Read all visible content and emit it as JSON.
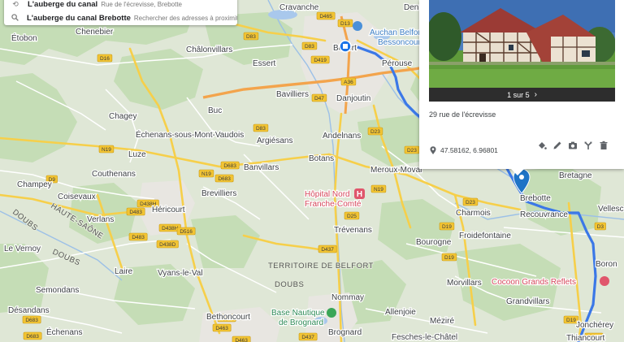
{
  "search": {
    "suggestions": [
      {
        "title": "L'auberge du canal",
        "subtitle": "Rue de l'écrevisse, Brebotte",
        "icon": "history-icon"
      },
      {
        "title": "L'auberge du canal Brebotte",
        "subtitle": "Rechercher des adresses à proximité de",
        "icon": "search-icon"
      }
    ]
  },
  "card": {
    "pager": "1 sur 5",
    "address": "29 rue de l'écrevisse",
    "coordinates": "47.58162, 6.96801",
    "tools": [
      "paint-bucket-icon",
      "pencil-icon",
      "camera-icon",
      "directions-icon",
      "trash-icon"
    ]
  },
  "map": {
    "towns": [
      "Cravanche",
      "Chenebier",
      "Étobon",
      "Châlonvillars",
      "Essert",
      "Belfort",
      "Pérouse",
      "Bavilliers",
      "Danjoutin",
      "Buc",
      "Chagey",
      "Échenans-sous-Mont-Vaudois",
      "Andelnans",
      "Argiésans",
      "Luze",
      "Botans",
      "Meroux-Moval",
      "Banvillars",
      "Couthenans",
      "Champey",
      "Coisevaux",
      "Brevilliers",
      "Héricourt",
      "Verlans",
      "Trévenans",
      "Le Vernoy",
      "Bourogne",
      "Laire",
      "Vyans-le-Val",
      "Semondans",
      "Nommay",
      "Allenjoie",
      "Désandans",
      "Bethoncourt",
      "Échenans",
      "Brognard",
      "Méziré",
      "Fesches-le-Châtel",
      "Charmois",
      "Froidefontaine",
      "Morvillars",
      "Grandvillars",
      "Bretagne",
      "Vellescot",
      "Brebotte",
      "Recouvrance",
      "Boron",
      "Jonchérey",
      "Thiancourt",
      "Denney"
    ],
    "regions": [
      "DOUBS",
      "HAUTE-SAÔNE",
      "TERRITOIRE DE BELFORT",
      "DOUBS",
      "DOUBS"
    ],
    "pois": [
      {
        "name": "Hôpital Nord Franche-Comté",
        "type": "hospital"
      },
      {
        "name": "Auchan Belfort Bessoncourt",
        "type": "shopping"
      },
      {
        "name": "Cocoon Grands Reflets",
        "type": "lodging"
      },
      {
        "name": "Base Nautique de Brognard",
        "type": "park"
      }
    ],
    "roads": [
      "D465",
      "D13",
      "D83",
      "D16",
      "D419",
      "D83",
      "A36",
      "D47",
      "D23",
      "D83",
      "N19",
      "D683",
      "N19",
      "D9",
      "D23",
      "N19",
      "D438H",
      "D483",
      "D438H",
      "D516",
      "D438D",
      "D483",
      "D683",
      "D25",
      "D437",
      "D19",
      "D19",
      "D23",
      "D3",
      "D463",
      "D438",
      "D437",
      "D463",
      "D19",
      "D463",
      "D683",
      "D683"
    ]
  }
}
